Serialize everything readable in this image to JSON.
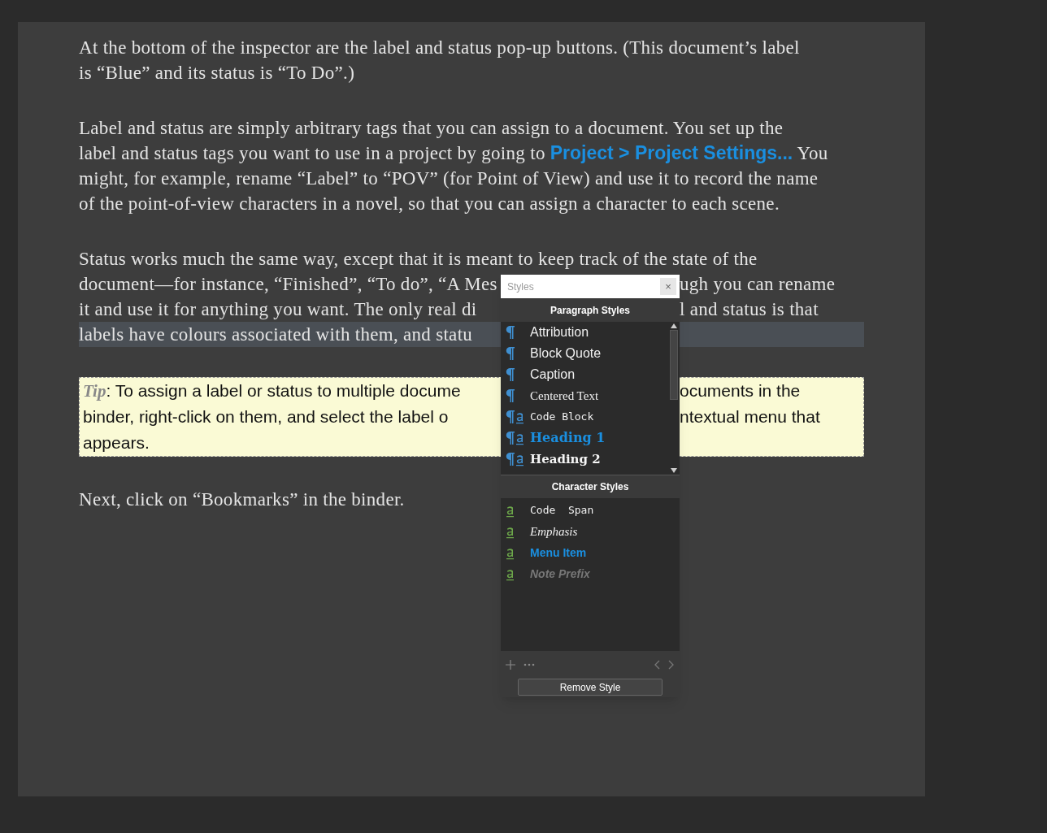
{
  "document": {
    "paragraphs": [
      {
        "kind": "body",
        "lines": [
          {
            "left": [
              {
                "kind": "plain",
                "text": "At the bottom of the inspector are the label and status pop-up buttons. (This document’s label"
              }
            ]
          },
          {
            "left": [
              {
                "kind": "plain",
                "text": "is “Blue” and its status is “To Do”.)"
              }
            ]
          }
        ]
      },
      {
        "kind": "body",
        "lines": [
          {
            "left": [
              {
                "kind": "plain",
                "text": "Label and status are simply arbitrary tags that you can assign to a document. You set up the"
              }
            ]
          },
          {
            "left": [
              {
                "kind": "plain",
                "text": "label and status tags you want to use in a project by going to "
              },
              {
                "kind": "link",
                "text": "Project > Project Settings..."
              },
              {
                "kind": "plain",
                "text": " You"
              }
            ]
          },
          {
            "left": [
              {
                "kind": "plain",
                "text": "might, for example, rename “Label” to “POV” (for Point of View) and use it to record the name"
              }
            ]
          },
          {
            "left": [
              {
                "kind": "plain",
                "text": "of the point-of-view characters in a novel, so that you can assign a character to each scene."
              }
            ]
          }
        ]
      },
      {
        "kind": "body",
        "lines": [
          {
            "left": [
              {
                "kind": "plain",
                "text": "Status works much the same way, except that it is meant to keep track of the state of the"
              }
            ],
            "highlighted": false
          },
          {
            "left": [
              {
                "kind": "plain",
                "text": "document—for instance, “Finished”, “To do”, “A Mes"
              }
            ],
            "right": "ugh you can rename",
            "highlighted": false
          },
          {
            "left": [
              {
                "kind": "plain",
                "text": "it and use it for anything you want. The only real di"
              }
            ],
            "right": "l and status is that",
            "highlighted": false
          },
          {
            "left": [
              {
                "kind": "plain",
                "text": "labels have colours associated with them, and statu"
              }
            ],
            "highlighted": true
          }
        ]
      },
      {
        "kind": "tip",
        "prefix": "Tip",
        "lines": [
          {
            "left": [
              {
                "kind": "plain",
                "text": ": To assign a label or status to multiple docume"
              }
            ],
            "right": "ocuments in the"
          },
          {
            "left": [
              {
                "kind": "plain",
                "text": "binder, right-click on them, and select the label o"
              }
            ],
            "right": "ntextual menu that"
          },
          {
            "left": [
              {
                "kind": "plain",
                "text": "appears."
              }
            ]
          }
        ]
      },
      {
        "kind": "body",
        "lines": [
          {
            "left": [
              {
                "kind": "plain",
                "text": "Next, click on “Bookmarks” in the binder."
              }
            ]
          }
        ]
      }
    ]
  },
  "styles_panel": {
    "search": {
      "placeholder": "Styles"
    },
    "clear_button": "×",
    "sections": [
      {
        "title": "Paragraph Styles",
        "items": [
          "Attribution",
          "Block Quote",
          "Caption",
          "Centered Text",
          "Code Block",
          "Heading 1",
          "Heading 2"
        ]
      },
      {
        "title": "Character Styles",
        "items": [
          "Code  Span",
          "Emphasis",
          "Menu Item",
          "Note Prefix"
        ]
      }
    ],
    "remove_button": "Remove Style"
  }
}
